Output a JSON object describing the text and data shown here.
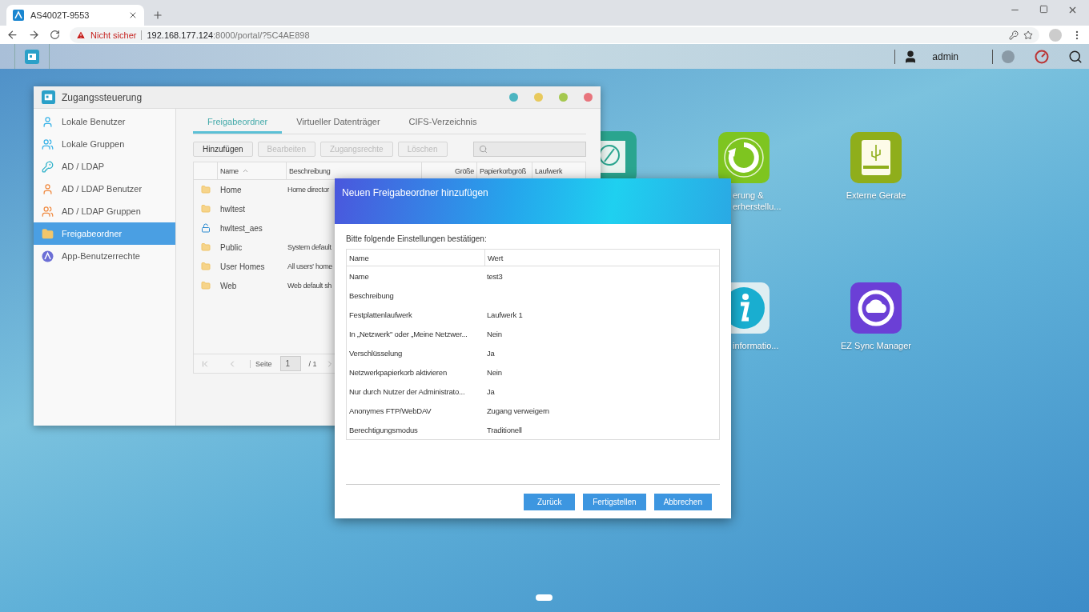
{
  "browser": {
    "tab": {
      "title": "AS4002T-9553"
    },
    "address": {
      "security": "Nicht sicher",
      "host": "192.168.177.124",
      "path": ":8000/portal/?5C4AE898"
    }
  },
  "taskbar": {
    "user": "admin"
  },
  "desktop_icons": [
    {
      "kind": "compass"
    },
    {
      "kind": "backup",
      "label_lines": [
        "erung &",
        "erherstellu..."
      ]
    },
    {
      "kind": "usb",
      "label_lines": [
        "Externe Gerate"
      ]
    },
    {
      "kind": "info",
      "label_lines": [
        "informatio..."
      ]
    },
    {
      "kind": "sync",
      "label_lines": [
        "EZ Sync Manager"
      ]
    }
  ],
  "window": {
    "title": "Zugangssteuerung",
    "sidebar": [
      {
        "label": "Lokale Benutzer",
        "kind": "user",
        "selected": false
      },
      {
        "label": "Lokale Gruppen",
        "kind": "group",
        "selected": false
      },
      {
        "label": "AD / LDAP",
        "kind": "key",
        "selected": false
      },
      {
        "label": "AD / LDAP Benutzer",
        "kind": "ldapuser",
        "selected": false
      },
      {
        "label": "AD / LDAP Gruppen",
        "kind": "ldapgroup",
        "selected": false
      },
      {
        "label": "Freigabeordner",
        "kind": "folder",
        "selected": true
      },
      {
        "label": "App-Benutzerrechte",
        "kind": "app",
        "selected": false
      }
    ],
    "tabs": [
      {
        "label": "Freigabeordner",
        "selected": true
      },
      {
        "label": "Virtueller Datenträger",
        "selected": false
      },
      {
        "label": "CIFS-Verzeichnis",
        "selected": false
      }
    ],
    "toolbar": [
      {
        "label": "Hinzufügen",
        "disabled": false
      },
      {
        "label": "Bearbeiten",
        "disabled": true
      },
      {
        "label": "Zugangsrechte",
        "disabled": true
      },
      {
        "label": "Löschen",
        "disabled": true
      }
    ],
    "table": {
      "columns": [
        "Name",
        "Beschreibung",
        "Größe",
        "Papierkorbgröß",
        "Laufwerk"
      ],
      "rows": [
        {
          "kind": "folder",
          "name": "Home",
          "description": "Home director"
        },
        {
          "kind": "folder",
          "name": "hwltest",
          "description": ""
        },
        {
          "kind": "locked",
          "name": "hwltest_aes",
          "description": ""
        },
        {
          "kind": "folder",
          "name": "Public",
          "description": "System default"
        },
        {
          "kind": "folder",
          "name": "User Homes",
          "description": "All users' home"
        },
        {
          "kind": "folder",
          "name": "Web",
          "description": "Web default sh"
        }
      ]
    },
    "pager": {
      "label": "Seite",
      "page": "1",
      "total": "/ 1"
    }
  },
  "dialog": {
    "title": "Neuen Freigabeordner hinzufügen",
    "intro": "Bitte folgende Einstellungen bestätigen:",
    "columns": [
      "Name",
      "Wert"
    ],
    "rows": [
      {
        "label": "Name",
        "value": "test3"
      },
      {
        "label": "Beschreibung",
        "value": ""
      },
      {
        "label": "Festplattenlaufwerk",
        "value": "Laufwerk 1"
      },
      {
        "label": "In „Netzwerk\" oder „Meine Netzwer...",
        "value": "Nein"
      },
      {
        "label": "Verschlüsselung",
        "value": "Ja"
      },
      {
        "label": "Netzwerkpapierkorb aktivieren",
        "value": "Nein"
      },
      {
        "label": "Nur durch Nutzer der Administrato...",
        "value": "Ja"
      },
      {
        "label": "Anonymes FTP/WebDAV",
        "value": "Zugang verweigern"
      },
      {
        "label": "Berechtigungsmodus",
        "value": "Traditionell"
      }
    ],
    "buttons": [
      "Zurück",
      "Fertigstellen",
      "Abbrechen"
    ]
  }
}
